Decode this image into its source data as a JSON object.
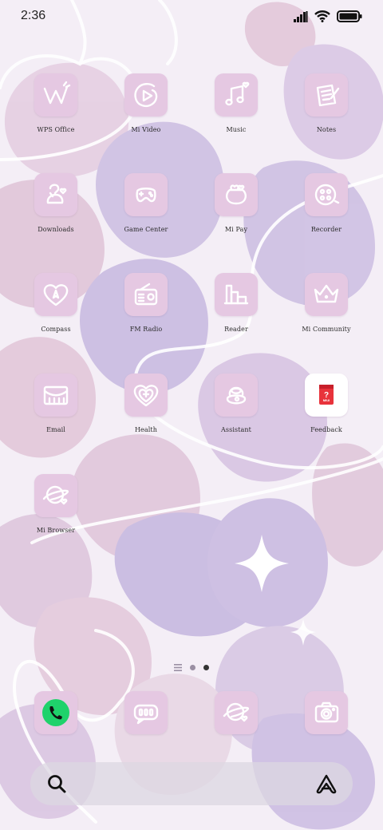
{
  "status_bar": {
    "time": "2:36"
  },
  "apps": [
    {
      "label": "WPS Office",
      "icon": "wps-office-icon"
    },
    {
      "label": "Mi Video",
      "icon": "mi-video-icon"
    },
    {
      "label": "Music",
      "icon": "music-icon"
    },
    {
      "label": "Notes",
      "icon": "notes-icon"
    },
    {
      "label": "Downloads",
      "icon": "downloads-icon"
    },
    {
      "label": "Game Center",
      "icon": "game-center-icon"
    },
    {
      "label": "Mi Pay",
      "icon": "mi-pay-icon"
    },
    {
      "label": "Recorder",
      "icon": "recorder-icon"
    },
    {
      "label": "Compass",
      "icon": "compass-icon"
    },
    {
      "label": "FM Radio",
      "icon": "fm-radio-icon"
    },
    {
      "label": "Reader",
      "icon": "reader-icon"
    },
    {
      "label": "Mi Community",
      "icon": "mi-community-icon"
    },
    {
      "label": "Email",
      "icon": "email-icon"
    },
    {
      "label": "Health",
      "icon": "health-icon"
    },
    {
      "label": "Assistant",
      "icon": "assistant-icon"
    },
    {
      "label": "Feedback",
      "icon": "feedback-icon",
      "badge": "MIUI"
    },
    {
      "label": "Mi Browser",
      "icon": "mi-browser-icon"
    }
  ],
  "page_indicator": {
    "pages": 2,
    "current": 2
  },
  "dock": [
    {
      "icon": "phone-icon"
    },
    {
      "icon": "messaging-icon"
    },
    {
      "icon": "browser-icon"
    },
    {
      "icon": "camera-icon"
    }
  ],
  "search_bar": {
    "left_icon": "search-icon",
    "right_icon": "assistant-a-icon"
  },
  "colors": {
    "tile": "#e5c8e2",
    "wallpaper_base": "#f4eef6",
    "heart_purple": "#c8b8e0",
    "heart_pink": "#e2c6d8",
    "phone_green": "#1fd26b"
  }
}
